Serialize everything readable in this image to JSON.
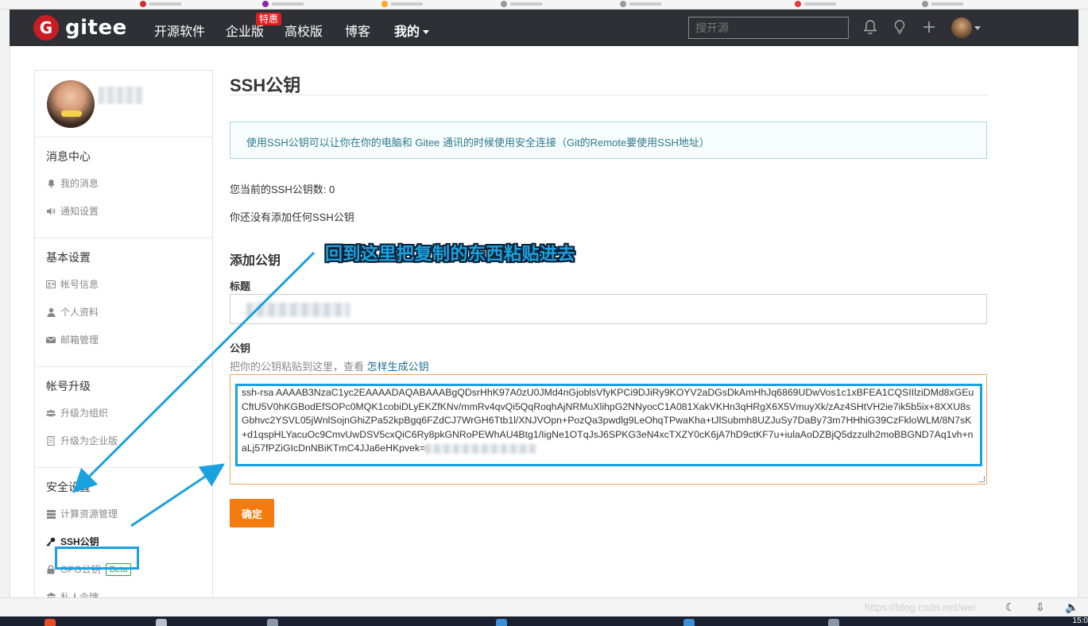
{
  "navbar": {
    "logo_mark": "G",
    "logo_text": "gitee",
    "items": [
      "开源软件",
      "企业版",
      "高校版",
      "博客",
      "我的"
    ],
    "enterprise_badge": "特惠",
    "search_placeholder": "搜开源"
  },
  "sidebar": {
    "sections": [
      {
        "title": "消息中心",
        "items": [
          {
            "icon": "bell-icon",
            "label": "我的消息"
          },
          {
            "icon": "speaker-icon",
            "label": "通知设置"
          }
        ]
      },
      {
        "title": "基本设置",
        "items": [
          {
            "icon": "id-card-icon",
            "label": "帐号信息"
          },
          {
            "icon": "user-icon",
            "label": "个人资料"
          },
          {
            "icon": "mail-icon",
            "label": "邮箱管理"
          }
        ]
      },
      {
        "title": "帐号升级",
        "items": [
          {
            "icon": "group-icon",
            "label": "升级为组织"
          },
          {
            "icon": "building-icon",
            "label": "升级为企业版"
          }
        ]
      },
      {
        "title": "安全设置",
        "items": [
          {
            "icon": "server-icon",
            "label": "计算资源管理"
          },
          {
            "icon": "key-icon",
            "label": "SSH公钥"
          },
          {
            "icon": "lock-icon",
            "label": "GPG公钥",
            "badge": "Beta"
          },
          {
            "icon": "ticket-icon",
            "label": "私人令牌"
          }
        ]
      }
    ]
  },
  "main": {
    "title": "SSH公钥",
    "info": "使用SSH公钥可以让你在你的电脑和 Gitee 通讯的时候使用安全连接（Git的Remote要使用SSH地址）",
    "key_count": "您当前的SSH公钥数: 0",
    "no_key": "你还没有添加任何SSH公钥",
    "add_title": "添加公钥",
    "title_label": "标题",
    "key_label": "公钥",
    "key_hint": "把你的公钥粘贴到这里，查看 ",
    "key_hint_link": "怎样生成公钥",
    "key_value": "ssh-rsa AAAAB3NzaC1yc2EAAAADAQABAAABgQDsrHhK97A0zU0JMd4nGjoblsVfyKPCi9DJiRy9KOYV2aDGsDkAmHhJq6869UDwVos1c1xBFEA1CQSIIlziDMd8xGEuCftU5V0hKGBodEfSOPc0MQK1cobiDLyEKZfKNv/mmRv4qvQi5QqRoqhAjNRMuXlihpG2NNyocC1A081XakVKHn3qHRgX6X5VmuyXk/zAz4SHtVH2ie7ik5b5ix+8XXU8sGbhvc2YSVL05jWnlSojnGhiZPa52kpBgq6FZdCJ7WrGH6Ttb1l/XNJVOpn+PozQa3pwdlg9LeOhqTPwaKha+tJlSubmh8UZJuSy7DaBy73m7HHhiG39CzFkloWLM/8N7sK+d1qspHLYacuOc9CmvUwDSV5cxQiC6Ry8pkGNRoPEWhAU4Btg1/IigNe1OTqJsJ6SPKG3eN4xcTXZY0cK6jA7hD9ctKF7u+iulaAoDZBjQ5dzzulh2moBBGND7Aq1vh+naLj57fPZiGIcDnNBiKTmC4JJa6eHKpvek=",
    "confirm": "确定"
  },
  "annotation": {
    "text": "回到这里把复制的东西粘贴进去",
    "color": "#1aa1e0"
  },
  "footer": {
    "watermark": "https://blog.csdn.net/wei",
    "clock": "15:0"
  }
}
